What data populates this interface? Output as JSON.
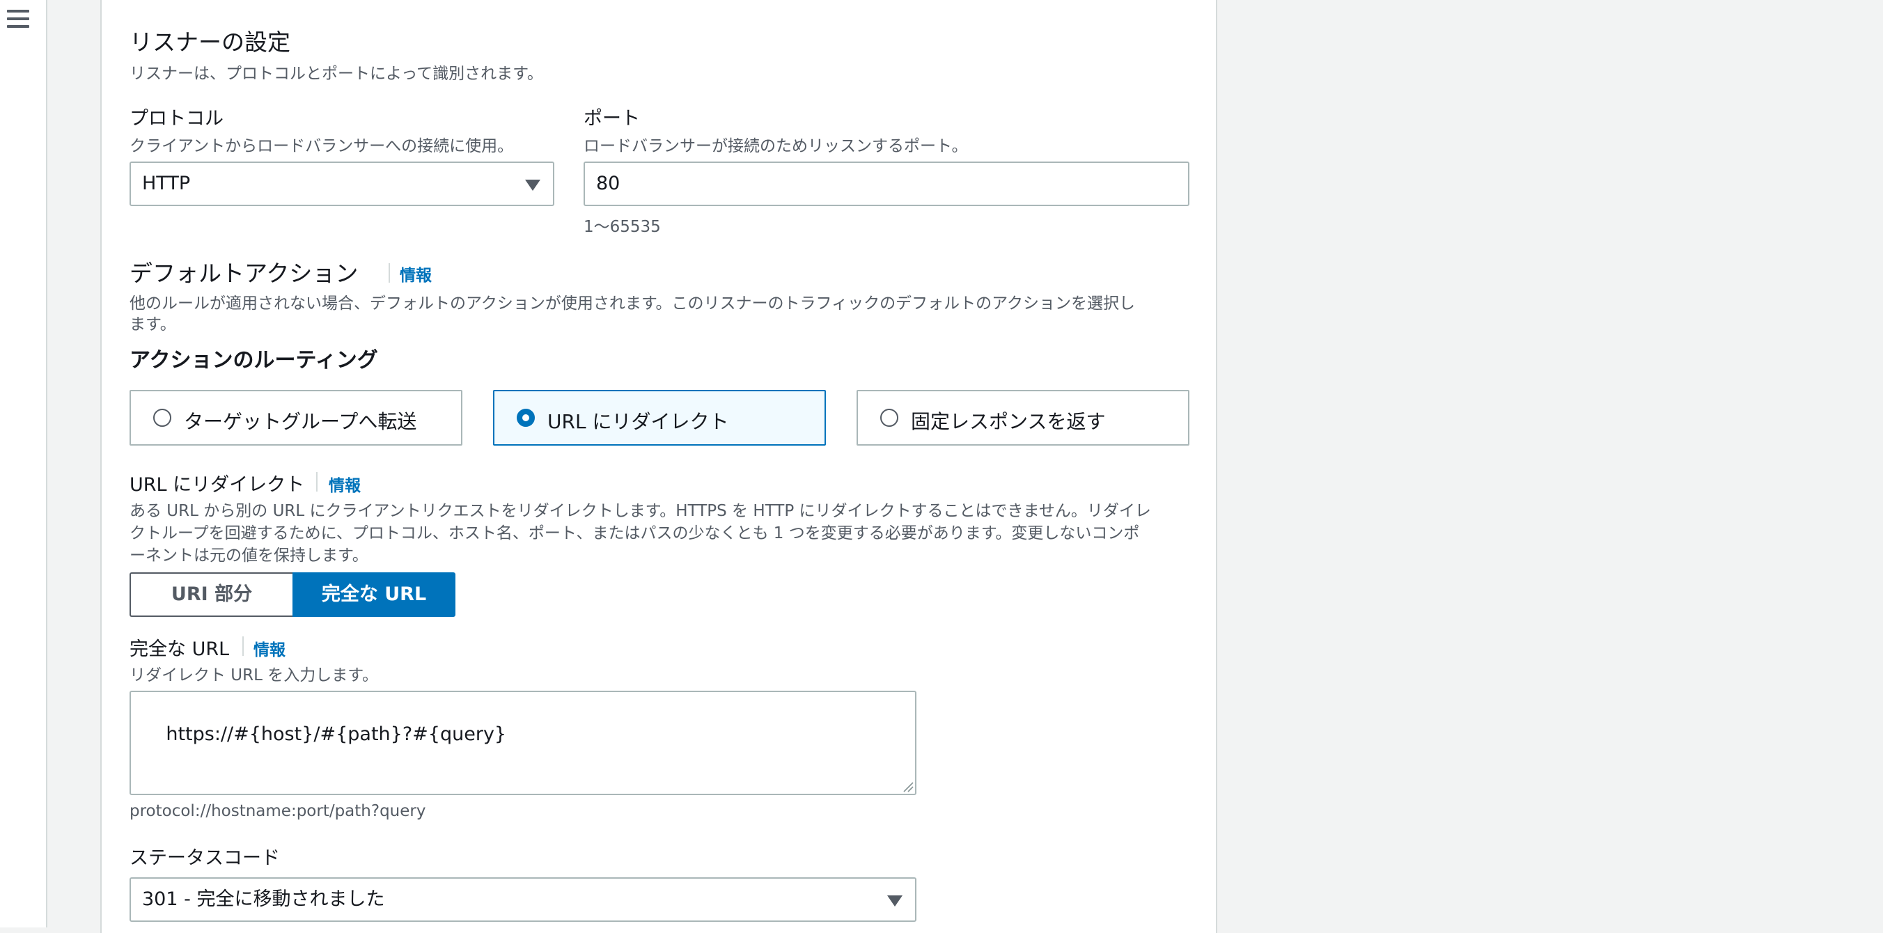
{
  "nav": {
    "menu_icon": "hamburger-menu-icon"
  },
  "listener": {
    "title": "リスナーの設定",
    "description": "リスナーは、プロトコルとポートによって識別されます。",
    "protocol": {
      "label": "プロトコル",
      "description": "クライアントからロードバランサーへの接続に使用。",
      "value": "HTTP"
    },
    "port": {
      "label": "ポート",
      "description": "ロードバランサーが接続のためリッスンするポート。",
      "value": "80",
      "hint": "1〜65535"
    }
  },
  "default_action": {
    "title": "デフォルトアクション",
    "info": "情報",
    "description_line1": "他のルールが適用されない場合、デフォルトのアクションが使用されます。このリスナーのトラフィックのデフォルトのアクションを選択し",
    "description_line2": "ます。"
  },
  "routing": {
    "title": "アクションのルーティング",
    "options": [
      {
        "label": "ターゲットグループへ転送",
        "selected": false
      },
      {
        "label": "URL にリダイレクト",
        "selected": true
      },
      {
        "label": "固定レスポンスを返す",
        "selected": false
      }
    ]
  },
  "redirect": {
    "title": "URL にリダイレクト",
    "info": "情報",
    "description_line1": "ある URL から別の URL にクライアントリクエストをリダイレクトします。HTTPS を HTTP にリダイレクトすることはできません。リダイレ",
    "description_line2": "クトループを回避するために、プロトコル、ホスト名、ポート、またはパスの少なくとも 1 つを変更する必要があります。変更しないコンポ",
    "description_line3": "ーネントは元の値を保持します。",
    "segments": [
      {
        "label": "URI 部分",
        "selected": false
      },
      {
        "label": "完全な URL",
        "selected": true
      }
    ]
  },
  "full_url": {
    "label": "完全な URL",
    "info": "情報",
    "description": "リダイレクト URL を入力します。",
    "value": "https://#{host}/#{path}?#{query}",
    "hint": "protocol://hostname:port/path?query"
  },
  "status_code": {
    "label": "ステータスコード",
    "value": "301 - 完全に移動されました"
  },
  "colors": {
    "accent": "#0073bb",
    "border": "#aab7b8",
    "selected_tile_bg": "#f1faff"
  }
}
